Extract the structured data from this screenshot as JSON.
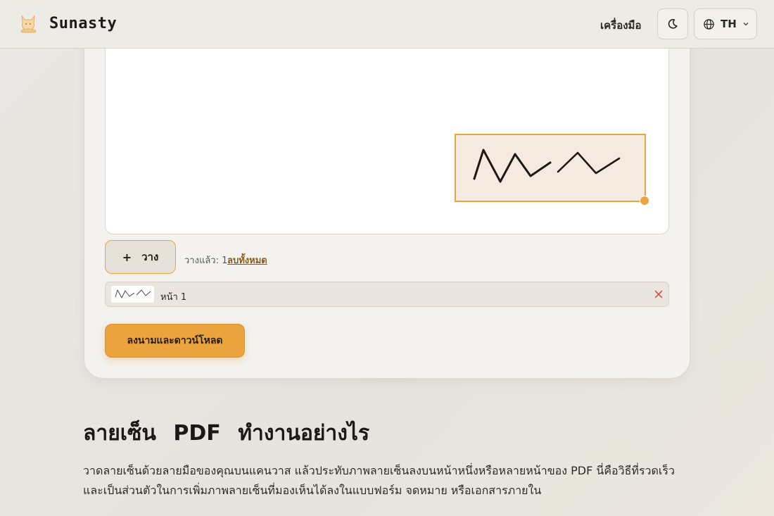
{
  "header": {
    "brand": "Sunasty",
    "tools_label": "เครื่องมือ",
    "language_code": "TH"
  },
  "signer": {
    "place_button_label": "วาง",
    "placed_count_text": "วางแล้ว: 1",
    "clear_all_label": "ลบทั้งหมด",
    "pages": [
      {
        "label": "หน้า 1"
      }
    ],
    "submit_label": "ลงนามและดาวน์โหลด"
  },
  "article": {
    "title": "ลายเซ็น PDF ทำงานอย่างไร",
    "paragraph_1": "วาดลายเซ็นด้วยลายมือของคุณบนแคนวาส แล้วประทับภาพลายเซ็นลงบนหน้าหนึ่งหรือหลายหน้าของ PDF นี่คือวิธีที่รวดเร็วและเป็นส่วนตัวในการเพิ่มภาพลายเซ็นที่มองเห็นได้ลงในแบบฟอร์ม จดหมาย หรือเอกสารภายใน"
  },
  "colors": {
    "accent": "#eaa33d",
    "accent_border": "#e8a542",
    "danger": "#c2473d"
  },
  "icons": {
    "logo": "fox-logo-icon",
    "theme": "moon-icon",
    "language": "globe-icon",
    "dropdown": "chevron-down-icon",
    "add": "plus-icon",
    "remove": "close-icon"
  }
}
